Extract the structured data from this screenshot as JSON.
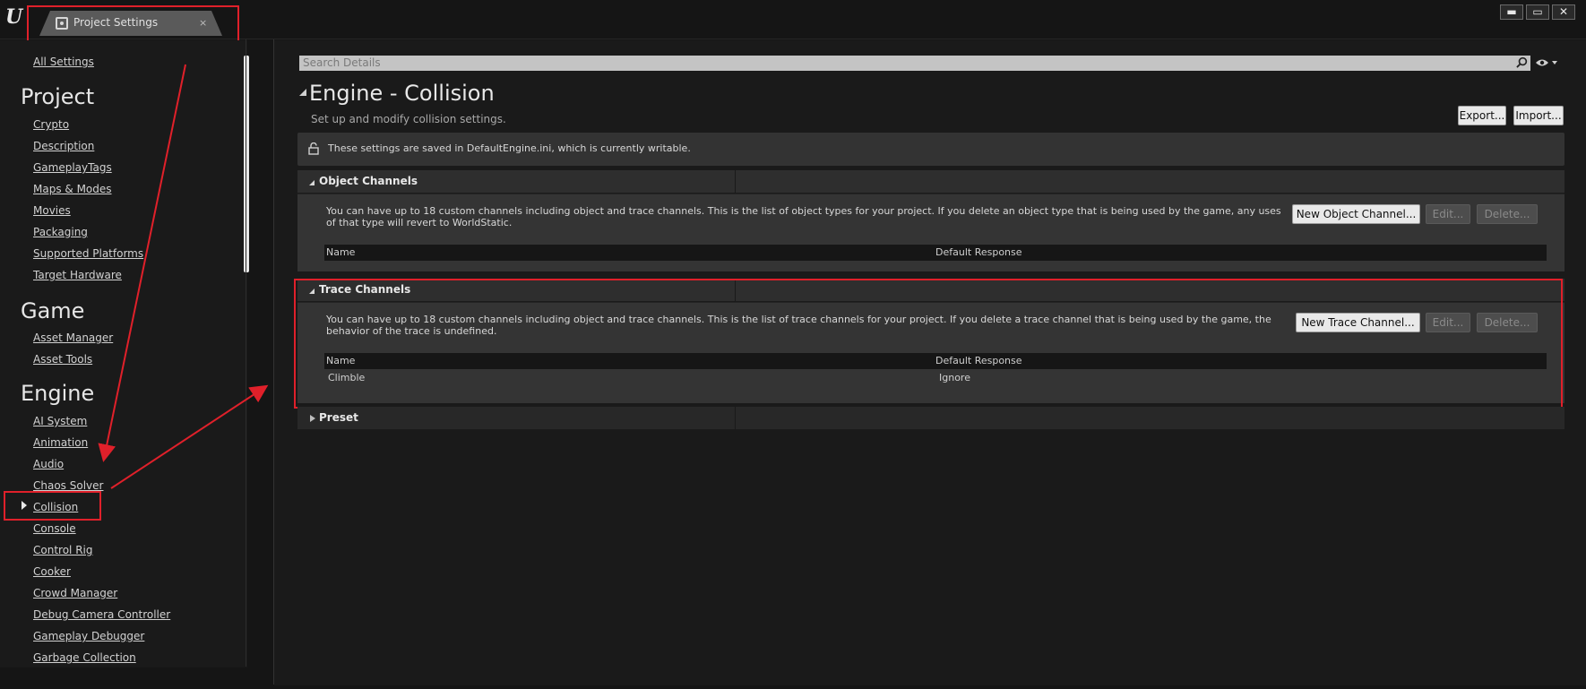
{
  "window": {
    "tab_label": "Project Settings",
    "tab_close": "×",
    "buttons": [
      "▬",
      "▭",
      "✕"
    ]
  },
  "nav": {
    "all_settings": "All Settings",
    "sections": [
      {
        "title": "Project",
        "items": [
          "Crypto",
          "Description",
          "GameplayTags",
          "Maps & Modes",
          "Movies",
          "Packaging",
          "Supported Platforms",
          "Target Hardware"
        ]
      },
      {
        "title": "Game",
        "items": [
          "Asset Manager",
          "Asset Tools"
        ]
      },
      {
        "title": "Engine",
        "items": [
          "AI System",
          "Animation",
          "Audio",
          "Chaos Solver",
          "Collision",
          "Console",
          "Control Rig",
          "Cooker",
          "Crowd Manager",
          "Debug Camera Controller",
          "Gameplay Debugger",
          "Garbage Collection"
        ]
      }
    ],
    "selected": "Collision"
  },
  "search": {
    "placeholder": "Search Details"
  },
  "page": {
    "title": "Engine - Collision",
    "description": "Set up and modify collision settings.",
    "export_label": "Export...",
    "import_label": "Import...",
    "notice": "These settings are saved in DefaultEngine.ini, which is currently writable."
  },
  "object_channels": {
    "title": "Object Channels",
    "description": "You can have up to 18 custom channels including object and trace channels. This is the list of object types for your project. If you delete an object type that is being used by the game, any uses of that type will revert to WorldStatic.",
    "new_label": "New Object Channel...",
    "edit_label": "Edit...",
    "delete_label": "Delete...",
    "col_name": "Name",
    "col_response": "Default Response"
  },
  "trace_channels": {
    "title": "Trace Channels",
    "description": "You can have up to 18 custom channels including object and trace channels. This is the list of trace channels for your project. If you delete a trace channel that is being used by the game, the behavior of the trace is undefined.",
    "new_label": "New Trace Channel...",
    "edit_label": "Edit...",
    "delete_label": "Delete...",
    "col_name": "Name",
    "col_response": "Default Response",
    "rows": [
      {
        "name": "Climble",
        "response": "Ignore"
      }
    ]
  },
  "preset": {
    "title": "Preset"
  },
  "colors": {
    "annotation": "#e0202a",
    "background": "#1a1a1a",
    "panel": "#343434"
  }
}
